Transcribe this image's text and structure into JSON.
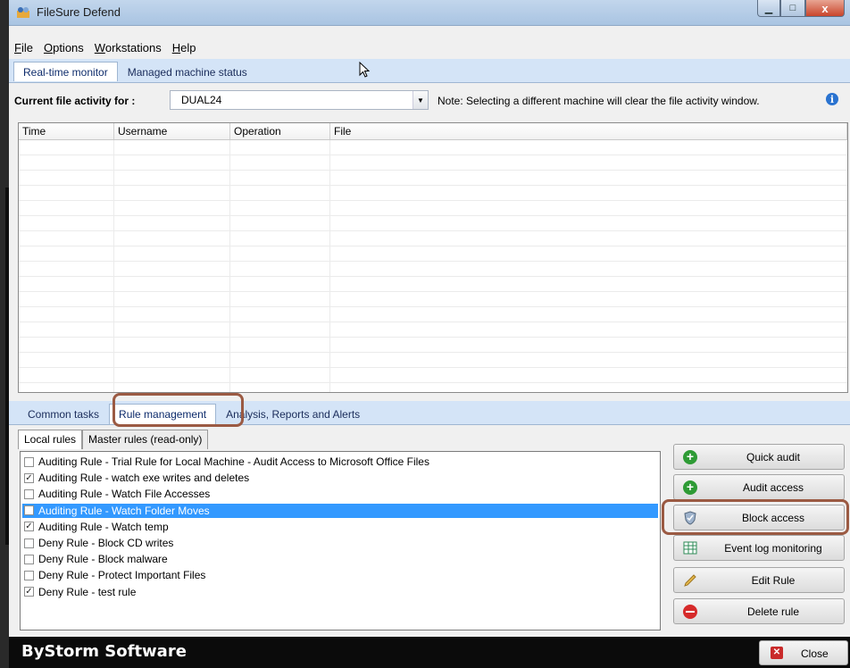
{
  "window": {
    "title": "FileSure Defend"
  },
  "menu": [
    {
      "accel": "F",
      "rest": "ile"
    },
    {
      "accel": "O",
      "rest": "ptions"
    },
    {
      "accel": "W",
      "rest": "orkstations"
    },
    {
      "accel": "H",
      "rest": "elp"
    }
  ],
  "top_tabs": [
    "Real-time monitor",
    "Managed machine status"
  ],
  "filter": {
    "label": "Current file activity for :",
    "machine": "DUAL24",
    "note": "Note: Selecting a different machine will clear the file activity window."
  },
  "grid": {
    "columns": [
      "Time",
      "Username",
      "Operation",
      "File"
    ]
  },
  "bottom_tabs": [
    "Common tasks",
    "Rule management",
    "Analysis, Reports and Alerts"
  ],
  "rule_tabs": [
    "Local rules",
    "Master rules (read-only)"
  ],
  "rules": [
    {
      "label": "Auditing Rule - Trial Rule for Local Machine - Audit Access to Microsoft Office Files",
      "checked": false
    },
    {
      "label": "Auditing Rule - watch exe writes and deletes",
      "checked": true
    },
    {
      "label": "Auditing Rule - Watch File Accesses",
      "checked": false
    },
    {
      "label": "Auditing Rule - Watch Folder Moves",
      "checked": false,
      "selected": true
    },
    {
      "label": "Auditing Rule - Watch temp",
      "checked": true
    },
    {
      "label": "Deny Rule - Block CD writes",
      "checked": false
    },
    {
      "label": "Deny Rule - Block malware",
      "checked": false
    },
    {
      "label": "Deny Rule - Protect Important Files",
      "checked": false
    },
    {
      "label": "Deny Rule - test rule",
      "checked": true
    }
  ],
  "buttons": {
    "quick_audit": "Quick audit",
    "audit_access": "Audit access",
    "block_access": "Block access",
    "event_log": "Event log monitoring",
    "edit_rule": "Edit Rule",
    "delete_rule": "Delete rule",
    "close": "Close"
  },
  "footer": {
    "brand": "ByStorm Software"
  },
  "colors": {
    "highlight_outline": "#9b5a43",
    "selection": "#3399ff",
    "tab_strip": "#d4e4f7"
  }
}
